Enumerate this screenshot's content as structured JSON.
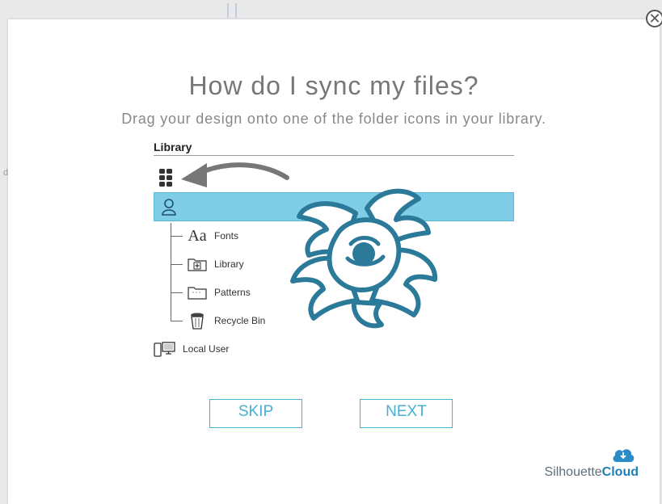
{
  "modal": {
    "title": "How do I sync my files?",
    "subtitle": "Drag your design onto one of the folder icons in your library.",
    "close_symbol": "✕"
  },
  "illustration": {
    "library_heading": "Library",
    "tree": [
      {
        "label": "Fonts",
        "icon": "font-icon"
      },
      {
        "label": "Library",
        "icon": "folder-plus-icon"
      },
      {
        "label": "Patterns",
        "icon": "folder-icon"
      },
      {
        "label": "Recycle Bin",
        "icon": "recycle-bin-icon"
      }
    ],
    "local_user": "Local User",
    "font_glyph": "Aa"
  },
  "buttons": {
    "skip": "SKIP",
    "next": "NEXT"
  },
  "brand": {
    "name_regular": "Silhouette",
    "name_bold": "Cloud"
  },
  "colors": {
    "accent": "#43b0d4",
    "selection": "#7fcde6",
    "flower": "#2b7a99",
    "brand_blue": "#1b7fb8"
  }
}
